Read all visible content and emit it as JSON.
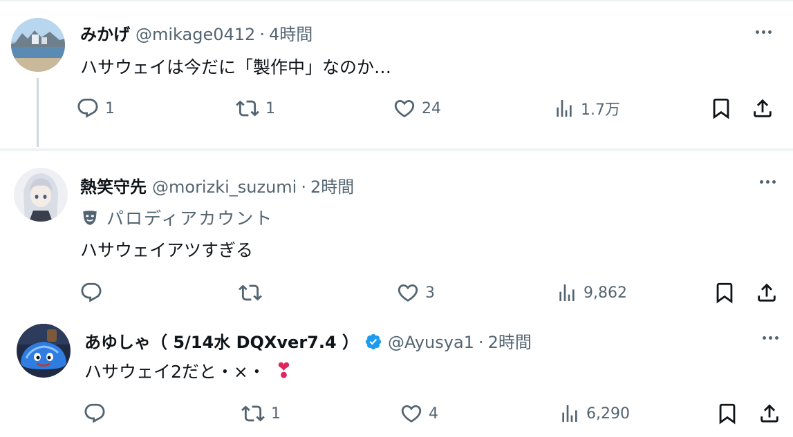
{
  "tweets": [
    {
      "name": "みかげ",
      "handle": "@mikage0412",
      "time": "4時間",
      "text": "ハサウェイは今だに「製作中」なのか…",
      "replies": "1",
      "retweets": "1",
      "likes": "24",
      "views": "1.7万"
    },
    {
      "name": "熱笑守先",
      "handle": "@morizki_suzumi",
      "time": "2時間",
      "parody_label": "パロディアカウント",
      "text": "ハサウェイアツすぎる",
      "replies": "",
      "retweets": "",
      "likes": "3",
      "views": "9,862"
    },
    {
      "name": "あゆしゃ（ 5/14水 DQXver7.4 ）",
      "handle": "@Ayusya1",
      "time": "2時間",
      "verified": true,
      "text": "ハサウェイ2だと・×・",
      "emoji": "❣",
      "replies": "",
      "retweets": "1",
      "likes": "4",
      "views": "6,290"
    }
  ],
  "separator_dot": "·",
  "colors": {
    "text": "#0f1419",
    "secondary": "#536471",
    "verified": "#1d9bf0",
    "emoji_heart": "#e0245e",
    "divider": "#eff3f4"
  },
  "icons": [
    "reply-icon",
    "retweet-icon",
    "like-icon",
    "views-icon",
    "bookmark-icon",
    "share-icon",
    "more-icon",
    "verified-badge-icon",
    "parody-mask-icon"
  ]
}
